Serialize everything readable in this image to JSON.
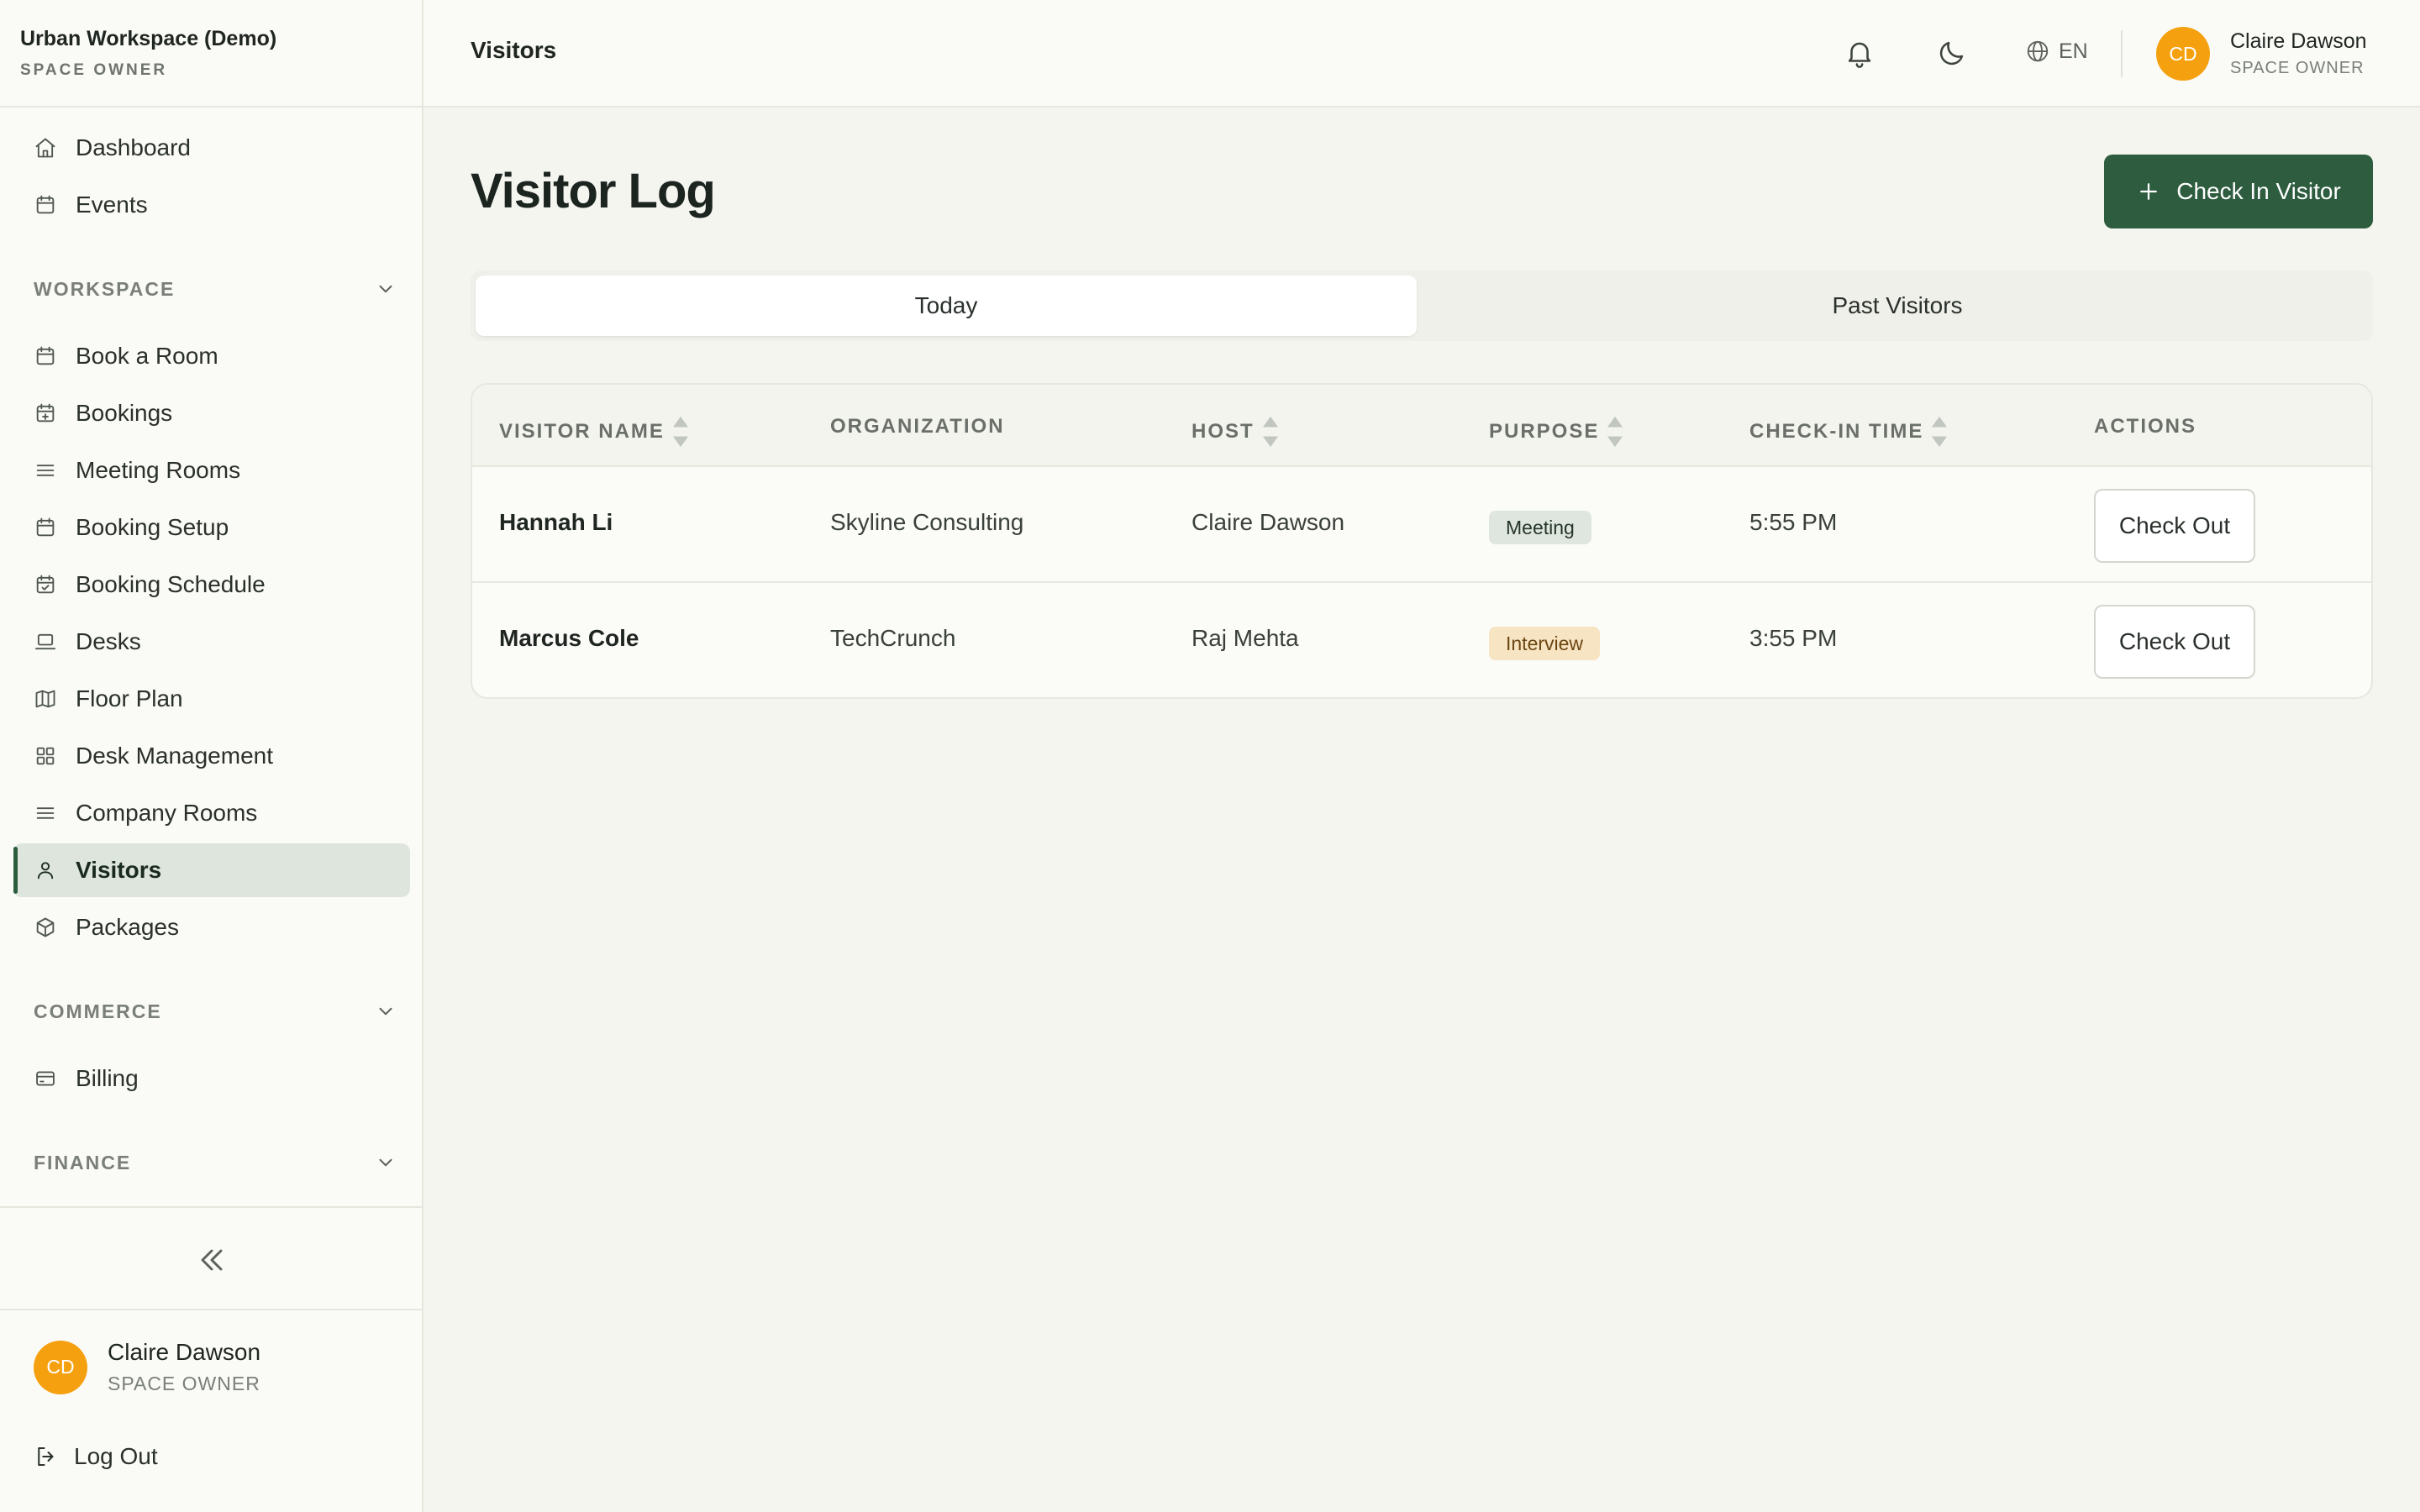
{
  "brand": {
    "name": "Urban Workspace (Demo)",
    "role": "SPACE OWNER"
  },
  "header": {
    "page": "Visitors",
    "language": "EN",
    "user": {
      "initials": "CD",
      "name": "Claire Dawson",
      "role": "SPACE OWNER"
    }
  },
  "sidebar": {
    "top_items": [
      {
        "label": "Dashboard",
        "icon": "home-icon"
      },
      {
        "label": "Events",
        "icon": "calendar-icon"
      }
    ],
    "sections": {
      "workspace": "WORKSPACE",
      "commerce": "COMMERCE",
      "finance": "FINANCE"
    },
    "workspace_items": [
      {
        "label": "Book a Room",
        "icon": "calendar-icon"
      },
      {
        "label": "Bookings",
        "icon": "calendar-plus-icon"
      },
      {
        "label": "Meeting Rooms",
        "icon": "list-icon"
      },
      {
        "label": "Booking Setup",
        "icon": "calendar-icon"
      },
      {
        "label": "Booking Schedule",
        "icon": "calendar-check-icon"
      },
      {
        "label": "Desks",
        "icon": "laptop-icon"
      },
      {
        "label": "Floor Plan",
        "icon": "map-icon"
      },
      {
        "label": "Desk Management",
        "icon": "grid-icon"
      },
      {
        "label": "Company Rooms",
        "icon": "list-icon"
      },
      {
        "label": "Visitors",
        "icon": "user-icon",
        "active": true
      },
      {
        "label": "Packages",
        "icon": "package-icon"
      }
    ],
    "commerce_items": [
      {
        "label": "Billing",
        "icon": "credit-card-icon"
      }
    ],
    "footer_user": {
      "initials": "CD",
      "name": "Claire Dawson",
      "role": "SPACE OWNER"
    },
    "logout": "Log Out"
  },
  "main": {
    "title": "Visitor Log",
    "primary_action": "Check In Visitor",
    "tabs": [
      {
        "label": "Today",
        "active": true
      },
      {
        "label": "Past Visitors",
        "active": false
      }
    ],
    "table": {
      "columns": [
        "VISITOR NAME",
        "ORGANIZATION",
        "HOST",
        "PURPOSE",
        "CHECK-IN TIME",
        "ACTIONS"
      ],
      "rows": [
        {
          "name": "Hannah Li",
          "organization": "Skyline Consulting",
          "host": "Claire Dawson",
          "purpose": "Meeting",
          "time": "5:55 PM",
          "action": "Check Out"
        },
        {
          "name": "Marcus Cole",
          "organization": "TechCrunch",
          "host": "Raj Mehta",
          "purpose": "Interview",
          "time": "3:55 PM",
          "action": "Check Out"
        }
      ]
    }
  },
  "colors": {
    "accent": "#2d5c3f",
    "avatar": "#f5a10f",
    "background": "#f5f5f0",
    "active_nav": "#dde5dd",
    "badge_meeting": "#dfe6df",
    "badge_interview": "#f7e4c3"
  }
}
